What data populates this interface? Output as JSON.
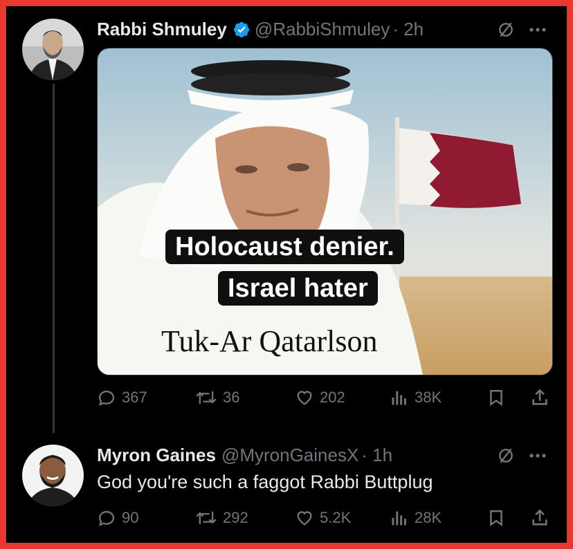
{
  "tweet1": {
    "author_name": "Rabbi Shmuley",
    "handle": "@RabbiShmuley",
    "time": "· 2h",
    "verified": true,
    "image_caption_line1": "Holocaust denier.",
    "image_caption_line2": "Israel hater",
    "image_signature": "Tuk-Ar Qatarlson",
    "stats": {
      "replies": "367",
      "reposts": "36",
      "likes": "202",
      "views": "38K"
    }
  },
  "tweet2": {
    "author_name": "Myron Gaines",
    "handle": "@MyronGainesX",
    "time": "· 1h",
    "text": "God you're such a faggot Rabbi Buttplug",
    "stats": {
      "replies": "90",
      "reposts": "292",
      "likes": "5.2K",
      "views": "28K"
    }
  },
  "colors": {
    "background": "#000000",
    "border": "#e8382f",
    "text": "#e7e9ea",
    "muted": "#71767b",
    "verified": "#1d9bf0"
  },
  "icons": [
    "reply-icon",
    "repost-icon",
    "like-icon",
    "views-icon",
    "bookmark-icon",
    "share-icon",
    "grok-icon",
    "more-icon",
    "verified-badge-icon"
  ]
}
